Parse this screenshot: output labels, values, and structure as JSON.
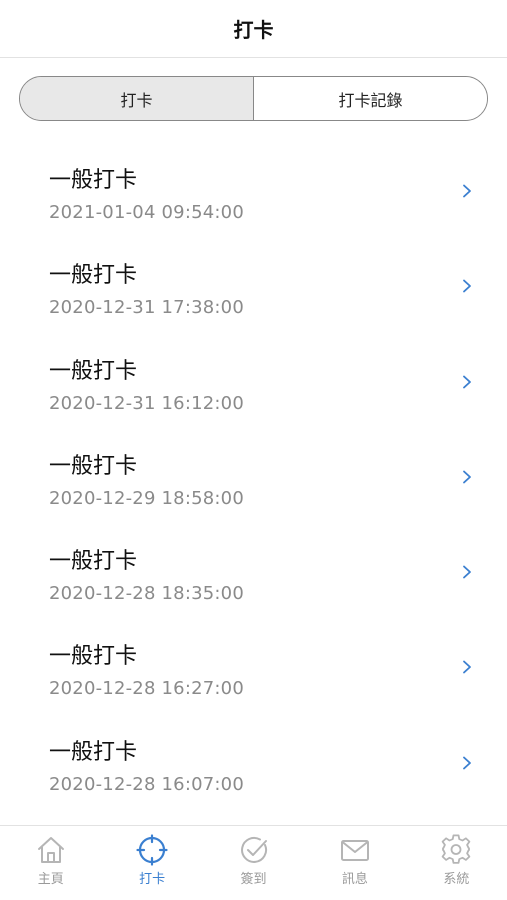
{
  "header": {
    "title": "打卡"
  },
  "segmented": {
    "tabs": [
      {
        "label": "打卡"
      },
      {
        "label": "打卡記錄"
      }
    ]
  },
  "records": [
    {
      "title": "一般打卡",
      "time": "2021-01-04 09:54:00"
    },
    {
      "title": "一般打卡",
      "time": "2020-12-31 17:38:00"
    },
    {
      "title": "一般打卡",
      "time": "2020-12-31 16:12:00"
    },
    {
      "title": "一般打卡",
      "time": "2020-12-29 18:58:00"
    },
    {
      "title": "一般打卡",
      "time": "2020-12-28 18:35:00"
    },
    {
      "title": "一般打卡",
      "time": "2020-12-28 16:27:00"
    },
    {
      "title": "一般打卡",
      "time": "2020-12-28 16:07:00"
    }
  ],
  "tabbar": {
    "items": [
      {
        "label": "主頁",
        "icon": "home-icon"
      },
      {
        "label": "打卡",
        "icon": "crosshair-icon"
      },
      {
        "label": "簽到",
        "icon": "check-circle-icon"
      },
      {
        "label": "訊息",
        "icon": "mail-icon"
      },
      {
        "label": "系統",
        "icon": "gear-icon"
      }
    ]
  },
  "colors": {
    "accent": "#3a7fd0",
    "inactive": "#b5b5b5",
    "muted_text": "#8a8a8a"
  }
}
